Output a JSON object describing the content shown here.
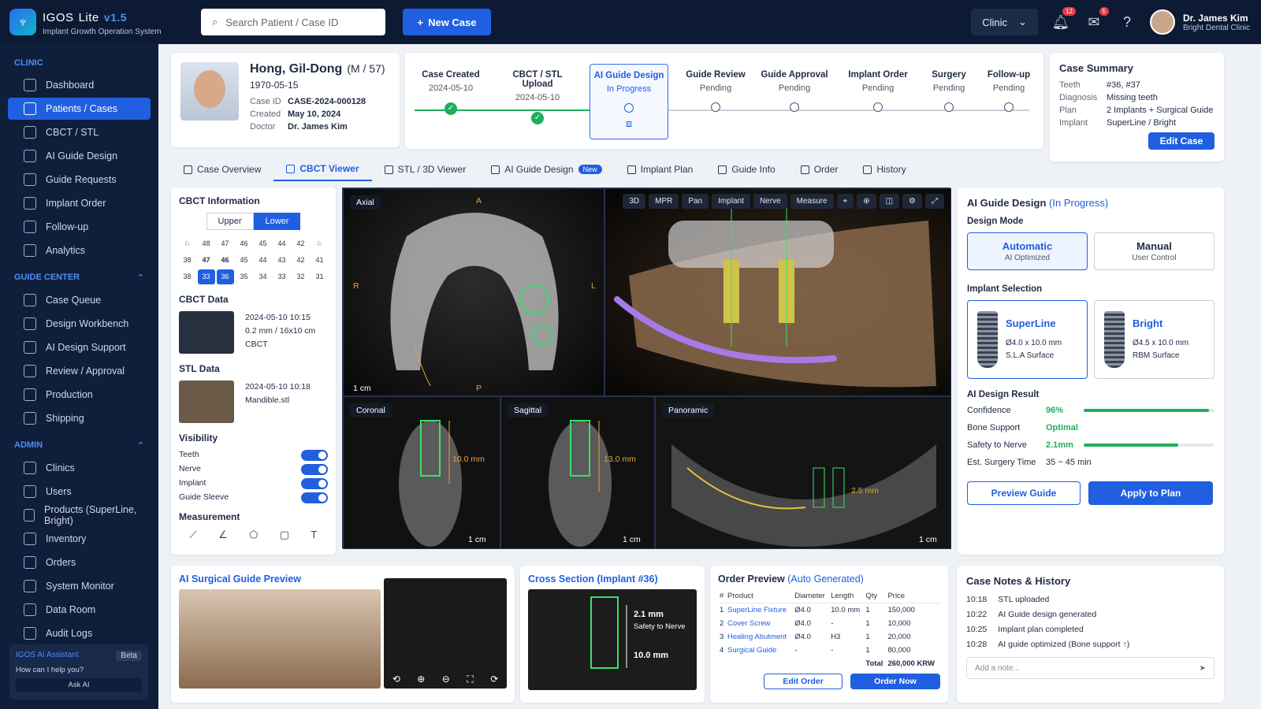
{
  "app": {
    "name": "IGOS",
    "edition": "Lite",
    "version": "v1.5",
    "subtitle": "Implant Growth Operation System"
  },
  "search": {
    "placeholder": "Search Patient / Case ID"
  },
  "new_case": "New Case",
  "clinic_select": "Clinic",
  "notifications": {
    "bell": "12",
    "messages": "5"
  },
  "user": {
    "name": "Dr. James Kim",
    "clinic": "Bright Dental Clinic"
  },
  "sidebar": {
    "clinic_title": "CLINIC",
    "clinic_items": [
      "Dashboard",
      "Patients / Cases",
      "CBCT / STL",
      "AI Guide Design",
      "Guide Requests",
      "Implant Order",
      "Follow-up",
      "Analytics"
    ],
    "guide_title": "GUIDE CENTER",
    "guide_items": [
      "Case Queue",
      "Design Workbench",
      "AI Design Support",
      "Review / Approval",
      "Production",
      "Shipping"
    ],
    "admin_title": "ADMIN",
    "admin_items": [
      "Clinics",
      "Users",
      "Products (SuperLine, Bright)",
      "Inventory",
      "Orders",
      "System Monitor",
      "Data Room",
      "Audit Logs"
    ],
    "assistant": {
      "title": "IGOS AI Assistant",
      "badge": "Beta",
      "question": "How can I help you?",
      "ask": "Ask AI"
    }
  },
  "patient": {
    "name": "Hong, Gil-Dong",
    "meta": "(M / 57)",
    "dob": "1970-05-15",
    "case_id_label": "Case ID",
    "case_id": "CASE-2024-000128",
    "created_label": "Created",
    "created": "May 10, 2024",
    "doctor_label": "Doctor",
    "doctor": "Dr. James Kim"
  },
  "steps": [
    {
      "name": "Case Created",
      "sub": "2024-05-10",
      "state": "done"
    },
    {
      "name": "CBCT / STL Upload",
      "sub": "2024-05-10",
      "state": "done"
    },
    {
      "name": "AI Guide Design",
      "sub": "In Progress",
      "state": "current"
    },
    {
      "name": "Guide Review",
      "sub": "Pending",
      "state": "pending"
    },
    {
      "name": "Guide Approval",
      "sub": "Pending",
      "state": "pending"
    },
    {
      "name": "Implant Order",
      "sub": "Pending",
      "state": "pending"
    },
    {
      "name": "Surgery",
      "sub": "Pending",
      "state": "pending"
    },
    {
      "name": "Follow-up",
      "sub": "Pending",
      "state": "pending"
    }
  ],
  "summary": {
    "title": "Case Summary",
    "rows": [
      [
        "Teeth",
        "#36, #37"
      ],
      [
        "Diagnosis",
        "Missing teeth"
      ],
      [
        "Plan",
        "2 Implants + Surgical Guide"
      ],
      [
        "Implant",
        "SuperLine / Bright"
      ]
    ],
    "edit": "Edit Case"
  },
  "tabs": [
    "Case Overview",
    "CBCT Viewer",
    "STL / 3D Viewer",
    "AI Guide Design",
    "Implant Plan",
    "Guide Info",
    "Order",
    "History"
  ],
  "tab_new_badge": "New",
  "cbct": {
    "title": "CBCT Information",
    "upper": "Upper",
    "lower": "Lower",
    "teeth_rows": [
      [
        "48",
        "47",
        "46",
        "45",
        "44",
        "42"
      ],
      [
        "38",
        "47",
        "46",
        "45",
        "44",
        "43",
        "42",
        "41"
      ],
      [
        "38",
        "33",
        "36",
        "35",
        "34",
        "33",
        "32",
        "31"
      ]
    ],
    "data_title": "CBCT Data",
    "data_lines": [
      "2024-05-10 10:15",
      "0.2 mm / 16x10 cm",
      "CBCT"
    ],
    "stl_title": "STL Data",
    "stl_lines": [
      "2024-05-10 10:18",
      "Mandible.stl"
    ],
    "vis_title": "Visibility",
    "vis": [
      "Teeth",
      "Nerve",
      "Implant",
      "Guide Sleeve"
    ],
    "meas_title": "Measurement"
  },
  "viewer": {
    "axial": "Axial",
    "coronal": "Coronal",
    "sagittal": "Sagittal",
    "panoramic": "Panoramic",
    "tools": [
      "3D",
      "MPR",
      "Pan",
      "Implant",
      "Nerve",
      "Measure"
    ],
    "scale": "1 cm",
    "cor_len": "10.0 mm",
    "sag_len": "13.0 mm",
    "pano_len": "2.5 mm",
    "A": "A",
    "P": "P",
    "R": "R",
    "L": "L"
  },
  "ai_design": {
    "title": "AI Guide Design",
    "status": "(In Progress)",
    "mode_title": "Design Mode",
    "auto": "Automatic",
    "auto_sub": "AI Optimized",
    "manual": "Manual",
    "manual_sub": "User Control",
    "impl_title": "Implant Selection",
    "implants": [
      {
        "name": "SuperLine",
        "size": "Ø4.0 x 10.0 mm",
        "surface": "S.L.A Surface"
      },
      {
        "name": "Bright",
        "size": "Ø4.5 x 10.0 mm",
        "surface": "RBM Surface"
      }
    ],
    "result_title": "AI Design Result",
    "results": [
      {
        "k": "Confidence",
        "v": "96%",
        "bar": 0.96
      },
      {
        "k": "Bone Support",
        "v": "Optimal"
      },
      {
        "k": "Safety to Nerve",
        "v": "2.1mm",
        "bar": 0.72
      },
      {
        "k": "Est. Surgery Time",
        "v": "35 ~ 45 min"
      }
    ],
    "preview": "Preview Guide",
    "apply": "Apply to Plan"
  },
  "guide_preview": {
    "title": "AI Surgical Guide Preview"
  },
  "cross": {
    "title": "Cross Section (Implant #36)",
    "d1": "2.1 mm",
    "d1s": "Safety to Nerve",
    "d2": "10.0 mm"
  },
  "order": {
    "title": "Order Preview",
    "sub": "(Auto Generated)",
    "headers": [
      "#",
      "Product",
      "Diameter",
      "Length",
      "Qty",
      "Price"
    ],
    "rows": [
      [
        "1",
        "SuperLine Fixture",
        "Ø4.0",
        "10.0 mm",
        "1",
        "150,000"
      ],
      [
        "2",
        "Cover Screw",
        "Ø4.0",
        "-",
        "1",
        "10,000"
      ],
      [
        "3",
        "Healing Abutment",
        "Ø4.0",
        "H3",
        "1",
        "20,000"
      ],
      [
        "4",
        "Surgical Guide",
        "-",
        "-",
        "1",
        "80,000"
      ]
    ],
    "total_label": "Total",
    "total": "260,000 KRW",
    "edit": "Edit Order",
    "now": "Order Now"
  },
  "notes": {
    "title": "Case Notes & History",
    "items": [
      [
        "10:18",
        "STL uploaded"
      ],
      [
        "10:22",
        "AI Guide design generated"
      ],
      [
        "10:25",
        "Implant plan completed"
      ],
      [
        "10:28",
        "AI guide optimized (Bone support ↑)"
      ]
    ],
    "placeholder": "Add a note..."
  }
}
